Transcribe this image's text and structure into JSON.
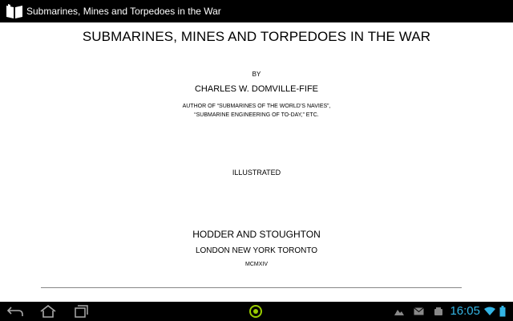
{
  "app": {
    "title": "Submarines, Mines and Torpedoes in the War",
    "icon": "book-icon"
  },
  "book": {
    "title": "SUBMARINES, MINES AND TORPEDOES IN THE WAR",
    "by": "BY",
    "author": "CHARLES W. DOMVILLE-FIFE",
    "credits_line1": "AUTHOR OF “SUBMARINES OF THE WORLD’S NAVIES”,",
    "credits_line2": "“SUBMARINE ENGINEERING OF TO-DAY,” ETC.",
    "illustrated": "ILLUSTRATED",
    "publisher": "HODDER AND STOUGHTON",
    "cities": "LONDON NEW YORK TORONTO",
    "year": "MCMXIV"
  },
  "status": {
    "time": "16:05",
    "accent_color": "#33b5e5",
    "icons": [
      "photo-notification-icon",
      "email-notification-icon",
      "android-notification-icon",
      "wifi-icon",
      "battery-icon"
    ]
  },
  "nav": {
    "buttons": [
      "back-icon",
      "home-icon",
      "recent-apps-icon",
      "center-ring-icon"
    ]
  }
}
